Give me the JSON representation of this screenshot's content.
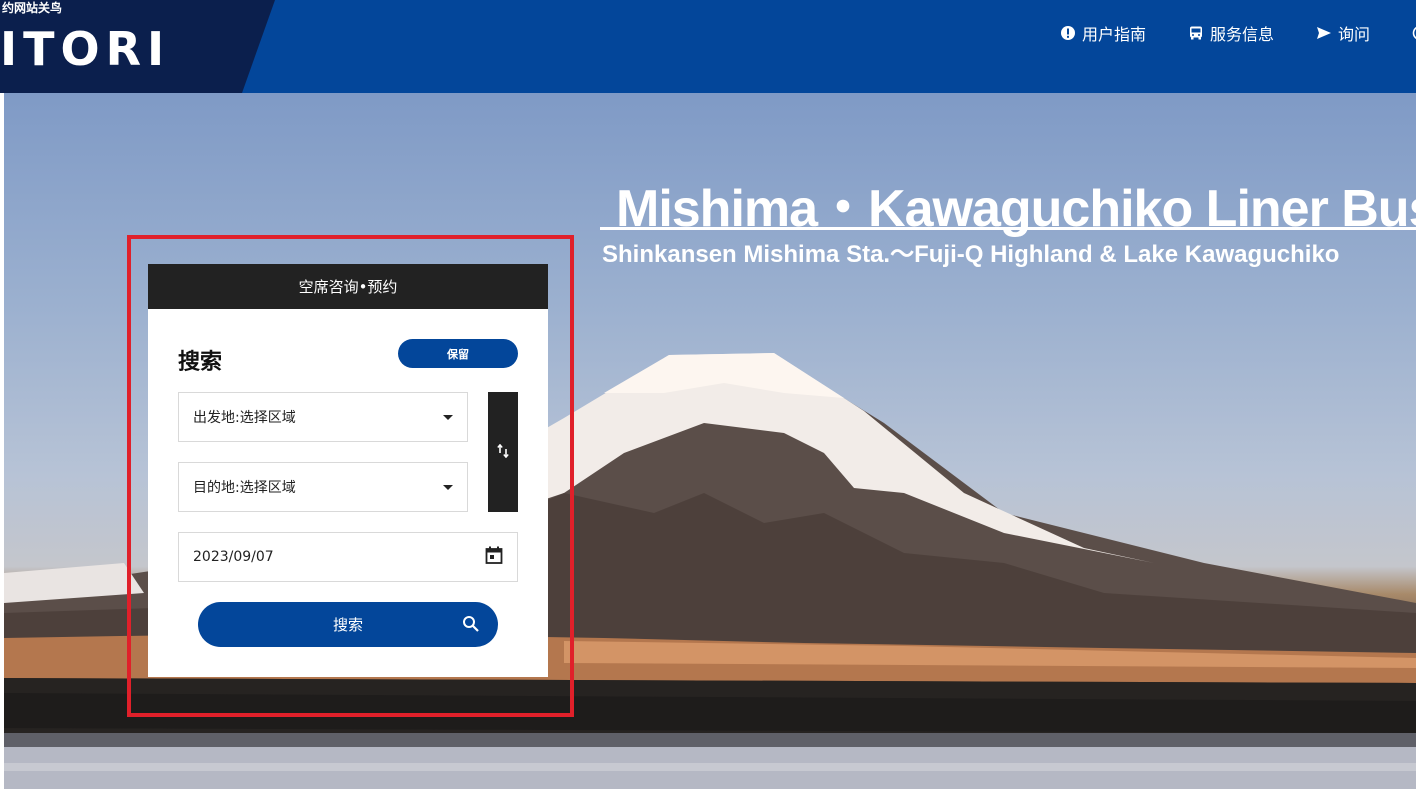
{
  "header": {
    "logo_tagline": "约网站关鸟",
    "logo_text": "ITORI",
    "nav": [
      {
        "label": "用户指南",
        "icon": "alert-circle-icon"
      },
      {
        "label": "服务信息",
        "icon": "bus-icon"
      },
      {
        "label": "询问",
        "icon": "send-icon"
      }
    ]
  },
  "hero": {
    "title": "Mishima・Kawaguchiko Liner Bus",
    "subtitle": "Shinkansen Mishima Sta.〜Fuji-Q Highland & Lake Kawaguchiko"
  },
  "widget": {
    "header": "空席咨询•预约",
    "title": "搜索",
    "reserve_label": "保留",
    "origin_value": "出发地:选择区域",
    "destination_value": "目的地:选择区域",
    "date_value": "2023/09/07",
    "search_label": "搜索",
    "icons": {
      "swap": "swap-vertical-icon",
      "calendar": "calendar-icon",
      "search": "search-icon"
    }
  },
  "colors": {
    "brand_blue": "#03469a",
    "dark": "#222222",
    "highlight": "#e0202a"
  }
}
